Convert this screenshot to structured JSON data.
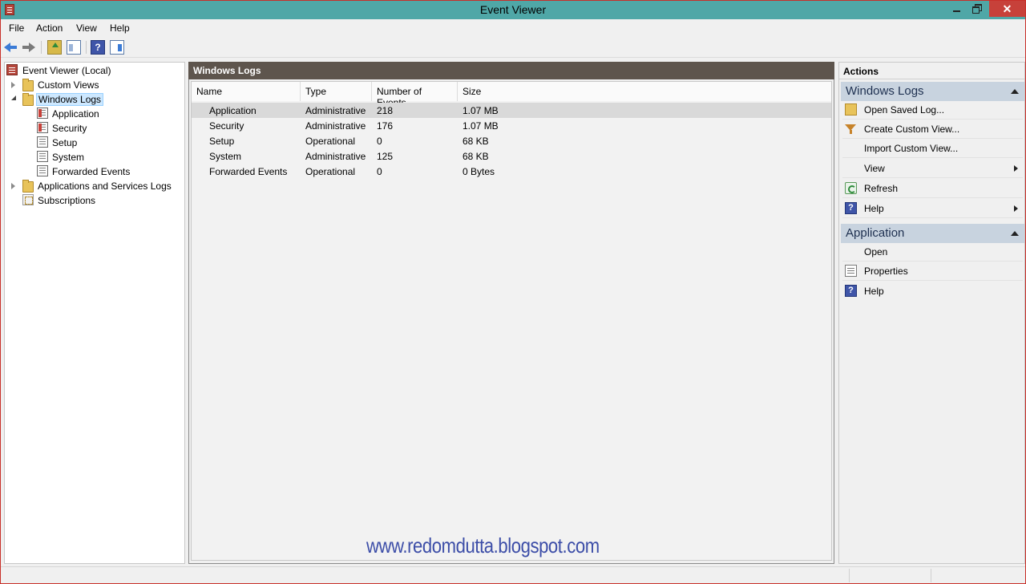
{
  "window": {
    "title": "Event Viewer",
    "close_glyph": "✕"
  },
  "menu": {
    "items": [
      "File",
      "Action",
      "View",
      "Help"
    ]
  },
  "toolbar": {
    "help_glyph": "?"
  },
  "tree": {
    "root": "Event Viewer (Local)",
    "custom_views": "Custom Views",
    "windows_logs": "Windows Logs",
    "children": [
      "Application",
      "Security",
      "Setup",
      "System",
      "Forwarded Events"
    ],
    "apps_services": "Applications and Services Logs",
    "subscriptions": "Subscriptions"
  },
  "center": {
    "header": "Windows Logs",
    "columns": [
      "Name",
      "Type",
      "Number of Events",
      "Size"
    ],
    "rows": [
      {
        "name": "Application",
        "type": "Administrative",
        "events": "218",
        "size": "1.07 MB"
      },
      {
        "name": "Security",
        "type": "Administrative",
        "events": "176",
        "size": "1.07 MB"
      },
      {
        "name": "Setup",
        "type": "Operational",
        "events": "0",
        "size": "68 KB"
      },
      {
        "name": "System",
        "type": "Administrative",
        "events": "125",
        "size": "68 KB"
      },
      {
        "name": "Forwarded Events",
        "type": "Operational",
        "events": "0",
        "size": "0 Bytes"
      }
    ],
    "watermark": "www.redomdutta.blogspot.com"
  },
  "actions": {
    "title": "Actions",
    "sections": [
      {
        "header": "Windows Logs",
        "items": [
          {
            "label": "Open Saved Log...",
            "icon": "open-folder-icon"
          },
          {
            "label": "Create Custom View...",
            "icon": "filter-icon"
          },
          {
            "label": "Import Custom View...",
            "icon": ""
          },
          {
            "label": "View",
            "icon": "",
            "submenu": true
          },
          {
            "label": "Refresh",
            "icon": "refresh-icon"
          },
          {
            "label": "Help",
            "icon": "help-icon",
            "submenu": true
          }
        ]
      },
      {
        "header": "Application",
        "items": [
          {
            "label": "Open",
            "icon": ""
          },
          {
            "label": "Properties",
            "icon": "properties-icon"
          },
          {
            "label": "Help",
            "icon": "help-icon"
          }
        ]
      }
    ]
  },
  "colors": {
    "titlebar": "#4fa7a7",
    "close_button": "#c7413a",
    "pane_header": "#5e554d",
    "section_header": "#c8d3df",
    "selection": "#cde8ff",
    "watermark": "#3d4ea8"
  }
}
